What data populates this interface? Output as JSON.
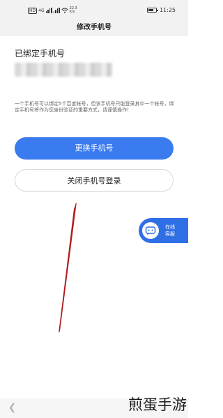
{
  "status_bar": {
    "hd_badge": "HD",
    "network_badge": "4G",
    "net_speed": "22.3 K/s",
    "time": "11:25",
    "icons": {
      "signal": "signal-icon",
      "wifi": "wifi-icon",
      "battery": "battery-icon"
    },
    "battery_level": 0.7
  },
  "nav": {
    "title": "修改手机号"
  },
  "content": {
    "bound_label": "已绑定手机号",
    "notice": "一个手机号可以绑定5个百度帐号，但该手机号只能登录其中一个帐号，绑定手机号将作为您身份验证的重要方式，请谨慎操作！"
  },
  "buttons": {
    "change_phone": "更换手机号",
    "close_phone_login": "关闭手机号登录"
  },
  "floating_service": {
    "line1": "在线",
    "line2": "客服",
    "icon": "customer-service-icon"
  },
  "bottom_nav": {
    "back_icon": "chevron-left-icon"
  },
  "watermark": {
    "text": "煎蛋手游"
  },
  "colors": {
    "primary": "#3a7bf0",
    "service": "#2f6fe6",
    "annotation_line": "#b01e1e"
  }
}
